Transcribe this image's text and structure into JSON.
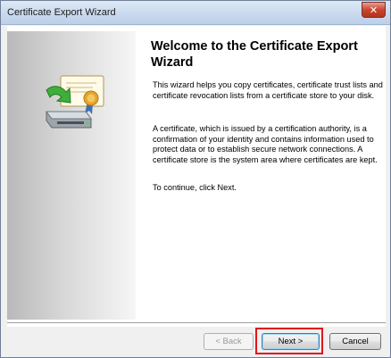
{
  "window": {
    "title": "Certificate Export Wizard",
    "close_glyph": "✕"
  },
  "banner": {
    "icon": "certificate-export-icon"
  },
  "main": {
    "heading": "Welcome to the Certificate Export Wizard",
    "paragraphs": [
      "This wizard helps you copy certificates, certificate trust lists and certificate revocation lists from a certificate store to your disk.",
      "A certificate, which is issued by a certification authority, is a confirmation of your identity and contains information used to protect data or to establish secure network connections. A certificate store is the system area where certificates are kept.",
      "To continue, click Next."
    ]
  },
  "buttons": {
    "back": "< Back",
    "next": "Next >",
    "cancel": "Cancel"
  },
  "colors": {
    "highlight": "#e1151b",
    "close_button": "#c9452f",
    "titlebar": "#c9d9ee"
  }
}
